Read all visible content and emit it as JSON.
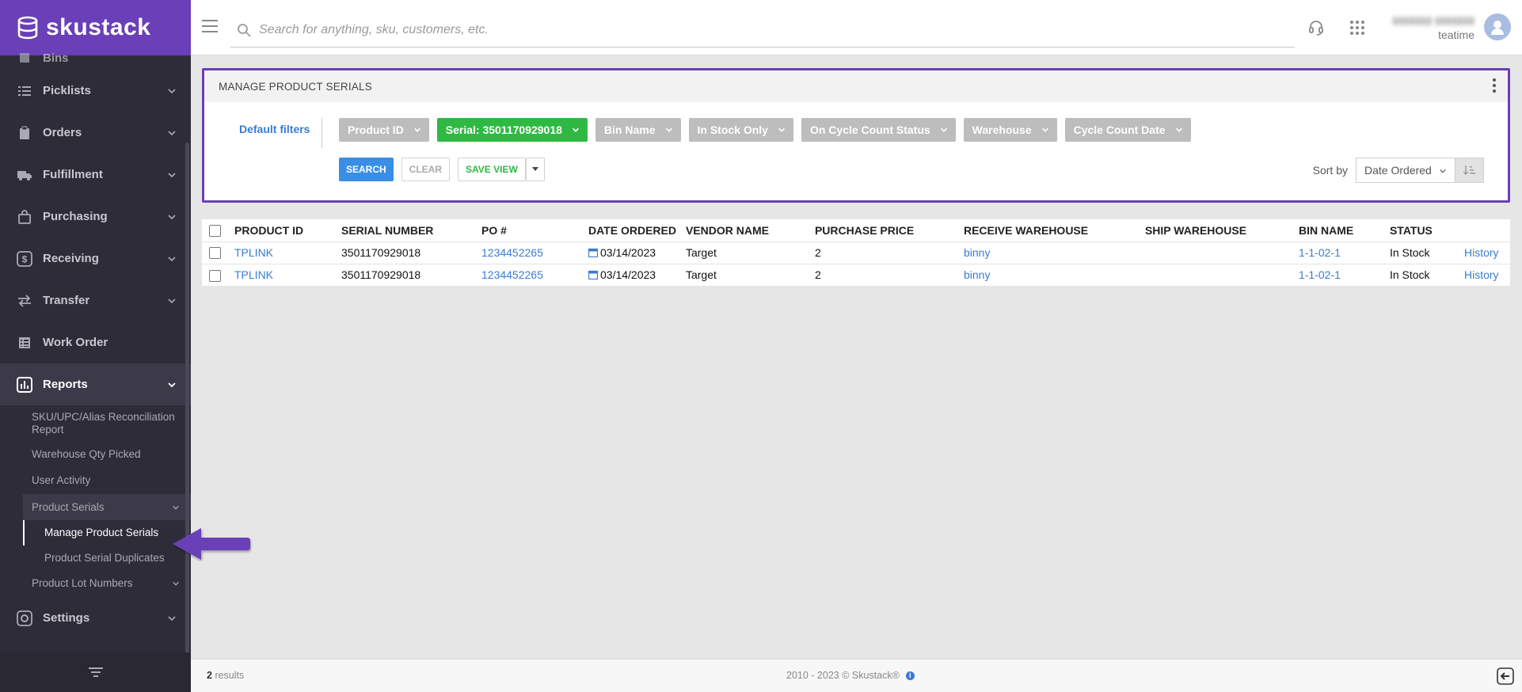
{
  "app": {
    "brand": "skustack",
    "brand_color": "#6a3fb8",
    "search_placeholder": "Search for anything, sku, customers, etc.",
    "user_company": "teatime",
    "icons": [
      "menu-icon",
      "search-icon",
      "headset-icon",
      "apps-grid-icon",
      "avatar-icon"
    ]
  },
  "sidebar": {
    "items": [
      {
        "label": "Bins",
        "icon": "bin-icon"
      },
      {
        "label": "Picklists",
        "icon": "list-icon"
      },
      {
        "label": "Orders",
        "icon": "clipboard-icon"
      },
      {
        "label": "Fulfillment",
        "icon": "truck-icon"
      },
      {
        "label": "Purchasing",
        "icon": "bag-icon"
      },
      {
        "label": "Receiving",
        "icon": "dollar-icon"
      },
      {
        "label": "Transfer",
        "icon": "transfer-icon"
      },
      {
        "label": "Work Order",
        "icon": "workorder-icon"
      },
      {
        "label": "Reports",
        "icon": "reports-icon"
      },
      {
        "label": "Settings",
        "icon": "gear-icon"
      }
    ],
    "reports_sub": [
      "SKU/UPC/Alias Reconciliation Report",
      "Warehouse Qty Picked",
      "User Activity",
      "Product Serials",
      "Manage Product Serials",
      "Product Serial Duplicates",
      "Product Lot Numbers"
    ]
  },
  "panel": {
    "title": "MANAGE PRODUCT SERIALS",
    "default_filters": "Default filters",
    "chips": [
      {
        "label": "Product ID",
        "active": false
      },
      {
        "label": "Serial: 3501170929018",
        "active": true
      },
      {
        "label": "Bin Name",
        "active": false
      },
      {
        "label": "In Stock Only",
        "active": false
      },
      {
        "label": "On Cycle Count Status",
        "active": false
      },
      {
        "label": "Warehouse",
        "active": false
      },
      {
        "label": "Cycle Count Date",
        "active": false
      }
    ],
    "buttons": {
      "search": "SEARCH",
      "clear": "CLEAR",
      "save_view": "SAVE VIEW"
    },
    "sort_label": "Sort by",
    "sort_value": "Date Ordered",
    "active_chip_color": "#2fb944"
  },
  "table": {
    "headers": [
      "PRODUCT ID",
      "SERIAL NUMBER",
      "PO #",
      "DATE ORDERED",
      "VENDOR NAME",
      "PURCHASE PRICE",
      "RECEIVE WAREHOUSE",
      "SHIP WAREHOUSE",
      "BIN NAME",
      "STATUS",
      ""
    ],
    "rows": [
      {
        "product_id": "TPLINK",
        "serial": "3501170929018",
        "po": "1234452265",
        "date": "03/14/2023",
        "vendor": "Target",
        "price": "2",
        "receive_wh": "binny",
        "ship_wh": "",
        "bin": "1-1-02-1",
        "status": "In Stock",
        "action": "History"
      },
      {
        "product_id": "TPLINK",
        "serial": "3501170929018",
        "po": "1234452265",
        "date": "03/14/2023",
        "vendor": "Target",
        "price": "2",
        "receive_wh": "binny",
        "ship_wh": "",
        "bin": "1-1-02-1",
        "status": "In Stock",
        "action": "History"
      }
    ]
  },
  "footer": {
    "count": "2",
    "count_label": "results",
    "copyright": "2010 - 2023 © Skustack®"
  }
}
